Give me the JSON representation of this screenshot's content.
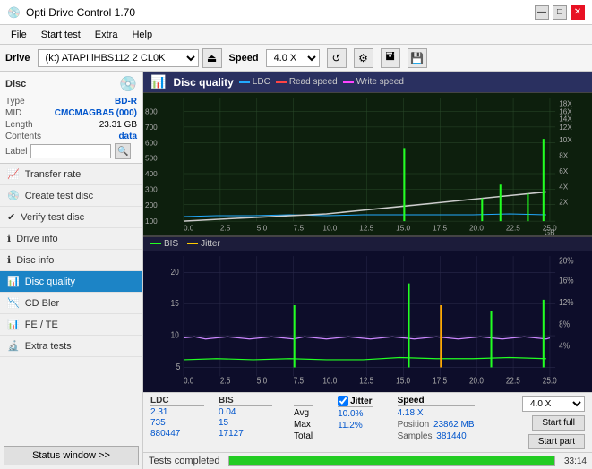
{
  "app": {
    "title": "Opti Drive Control 1.70",
    "icon": "💿"
  },
  "title_controls": {
    "minimize": "—",
    "maximize": "□",
    "close": "✕"
  },
  "menu": {
    "items": [
      "File",
      "Start test",
      "Extra",
      "Help"
    ]
  },
  "toolbar": {
    "drive_label": "Drive",
    "drive_value": "(k:) ATAPI iHBS112  2 CL0K",
    "speed_label": "Speed",
    "speed_value": "4.0 X",
    "eject_icon": "⏏",
    "refresh_icon": "↺",
    "settings_icon": "⚙",
    "burn_icon": "🖬",
    "save_icon": "💾"
  },
  "disc": {
    "title": "Disc",
    "type_label": "Type",
    "type_value": "BD-R",
    "mid_label": "MID",
    "mid_value": "CMCMAGBA5 (000)",
    "length_label": "Length",
    "length_value": "23.31 GB",
    "contents_label": "Contents",
    "contents_value": "data",
    "label_label": "Label",
    "label_placeholder": ""
  },
  "nav": {
    "items": [
      {
        "id": "transfer-rate",
        "label": "Transfer rate",
        "icon": "📈"
      },
      {
        "id": "create-test-disc",
        "label": "Create test disc",
        "icon": "💿"
      },
      {
        "id": "verify-test-disc",
        "label": "Verify test disc",
        "icon": "✔"
      },
      {
        "id": "drive-info",
        "label": "Drive info",
        "icon": "ℹ"
      },
      {
        "id": "disc-info",
        "label": "Disc info",
        "icon": "ℹ"
      },
      {
        "id": "disc-quality",
        "label": "Disc quality",
        "icon": "📊",
        "active": true
      },
      {
        "id": "cd-bler",
        "label": "CD Bler",
        "icon": "📉"
      },
      {
        "id": "fe-te",
        "label": "FE / TE",
        "icon": "📊"
      },
      {
        "id": "extra-tests",
        "label": "Extra tests",
        "icon": "🔬"
      }
    ]
  },
  "status_window_btn": "Status window >>",
  "chart": {
    "title": "Disc quality",
    "legend": [
      {
        "id": "ldc",
        "label": "LDC",
        "color": "#22aaff"
      },
      {
        "id": "read-speed",
        "label": "Read speed",
        "color": "#ff4444"
      },
      {
        "id": "write-speed",
        "label": "Write speed",
        "color": "#ff44ff"
      }
    ],
    "legend2": [
      {
        "id": "bis",
        "label": "BIS",
        "color": "#22ff22"
      },
      {
        "id": "jitter",
        "label": "Jitter",
        "color": "#ffcc00"
      }
    ],
    "upper_y_left": [
      "800",
      "700",
      "600",
      "500",
      "400",
      "300",
      "200",
      "100"
    ],
    "upper_y_right": [
      "18X",
      "16X",
      "14X",
      "12X",
      "10X",
      "8X",
      "6X",
      "4X",
      "2X"
    ],
    "lower_y_left": [
      "20",
      "15",
      "10",
      "5"
    ],
    "lower_y_right": [
      "20%",
      "16%",
      "12%",
      "8%",
      "4%"
    ],
    "x_labels": [
      "0.0",
      "2.5",
      "5.0",
      "7.5",
      "10.0",
      "12.5",
      "15.0",
      "17.5",
      "20.0",
      "22.5",
      "25.0"
    ],
    "x_unit": "GB"
  },
  "stats": {
    "headers": [
      "LDC",
      "BIS"
    ],
    "avg_label": "Avg",
    "avg_ldc": "2.31",
    "avg_bis": "0.04",
    "max_label": "Max",
    "max_ldc": "735",
    "max_bis": "15",
    "total_label": "Total",
    "total_ldc": "880447",
    "total_bis": "17127",
    "jitter_checked": true,
    "jitter_label": "Jitter",
    "jitter_avg": "10.0%",
    "jitter_max": "11.2%",
    "speed_label": "Speed",
    "speed_value": "4.18 X",
    "position_label": "Position",
    "position_value": "23862 MB",
    "samples_label": "Samples",
    "samples_value": "381440",
    "speed_select": "4.0 X",
    "btn_start_full": "Start full",
    "btn_start_part": "Start part"
  },
  "bottom": {
    "status_text": "Tests completed",
    "progress_pct": 100,
    "time_text": "33:14"
  }
}
